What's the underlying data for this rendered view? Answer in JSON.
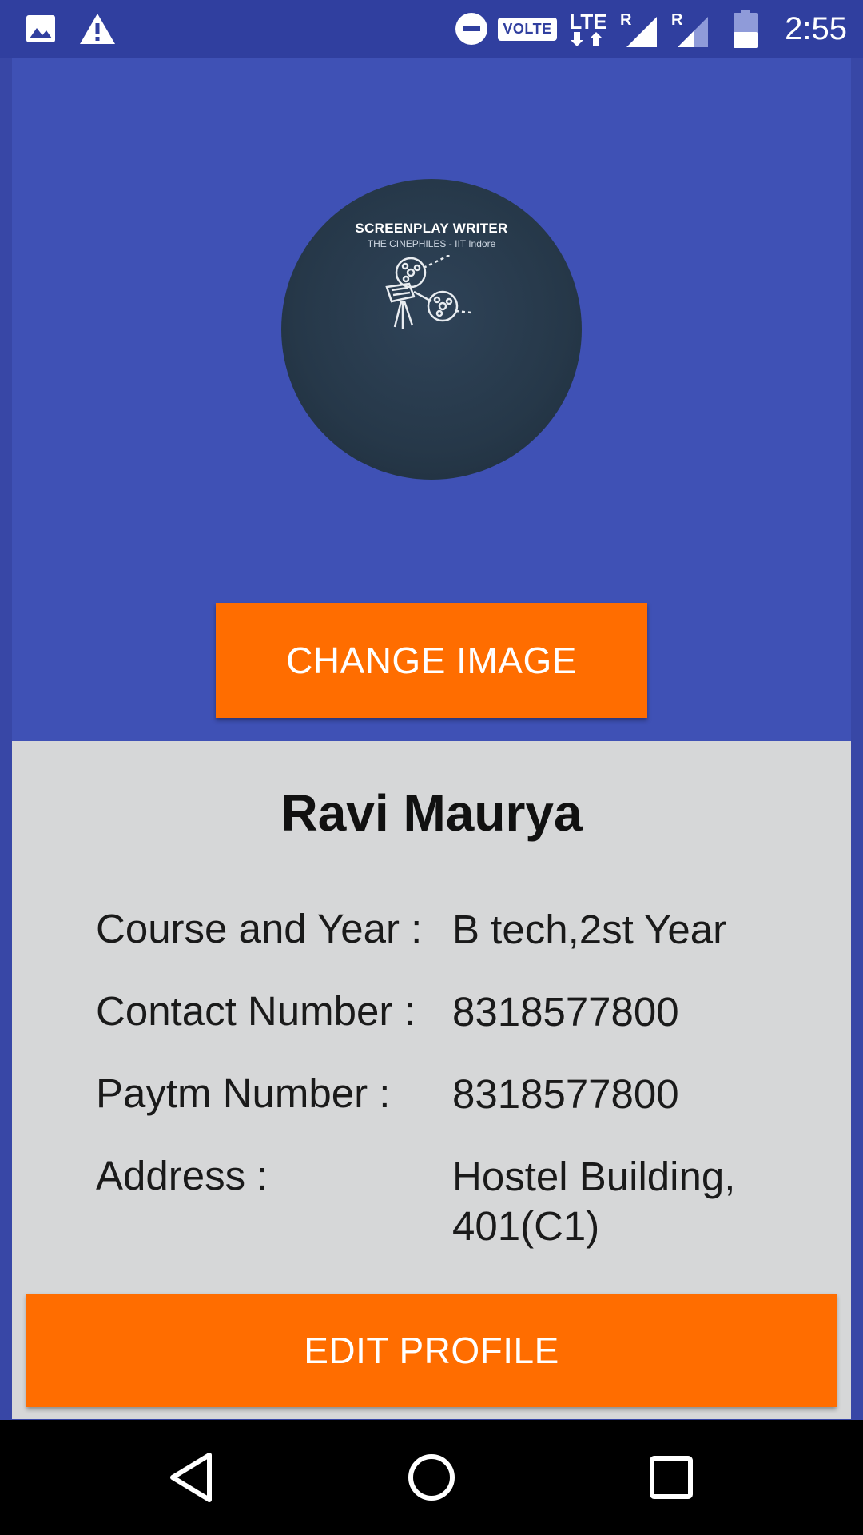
{
  "status_bar": {
    "time": "2:55",
    "volte": "VOLTE",
    "lte": "LTE",
    "roaming_1": "R",
    "roaming_2": "R",
    "icons": [
      "image-notification-icon",
      "warning-icon",
      "do-not-disturb-icon",
      "volte-icon",
      "lte-data-icon",
      "signal-icon",
      "signal-icon",
      "battery-icon"
    ]
  },
  "profile": {
    "avatar": {
      "title": "SCREENPLAY WRITER",
      "subtitle": "THE CINEPHILES - IIT Indore"
    },
    "change_image_label": "CHANGE IMAGE",
    "name": "Ravi Maurya",
    "fields": [
      {
        "label": "Course and Year  :",
        "value": "B tech,2st Year"
      },
      {
        "label": "Contact Number  :",
        "value": "8318577800"
      },
      {
        "label": "Paytm Number  :",
        "value": "8318577800"
      },
      {
        "label": "Address  :",
        "value": "Hostel Building, 401(C1)"
      }
    ],
    "edit_profile_label": "EDIT PROFILE"
  },
  "nav": {
    "icons": [
      "back-icon",
      "home-icon",
      "recents-icon"
    ]
  },
  "colors": {
    "status_bar": "#303f9f",
    "header": "#3f51b5",
    "accent": "#ff6d00",
    "content_background": "#d6d7d8"
  }
}
